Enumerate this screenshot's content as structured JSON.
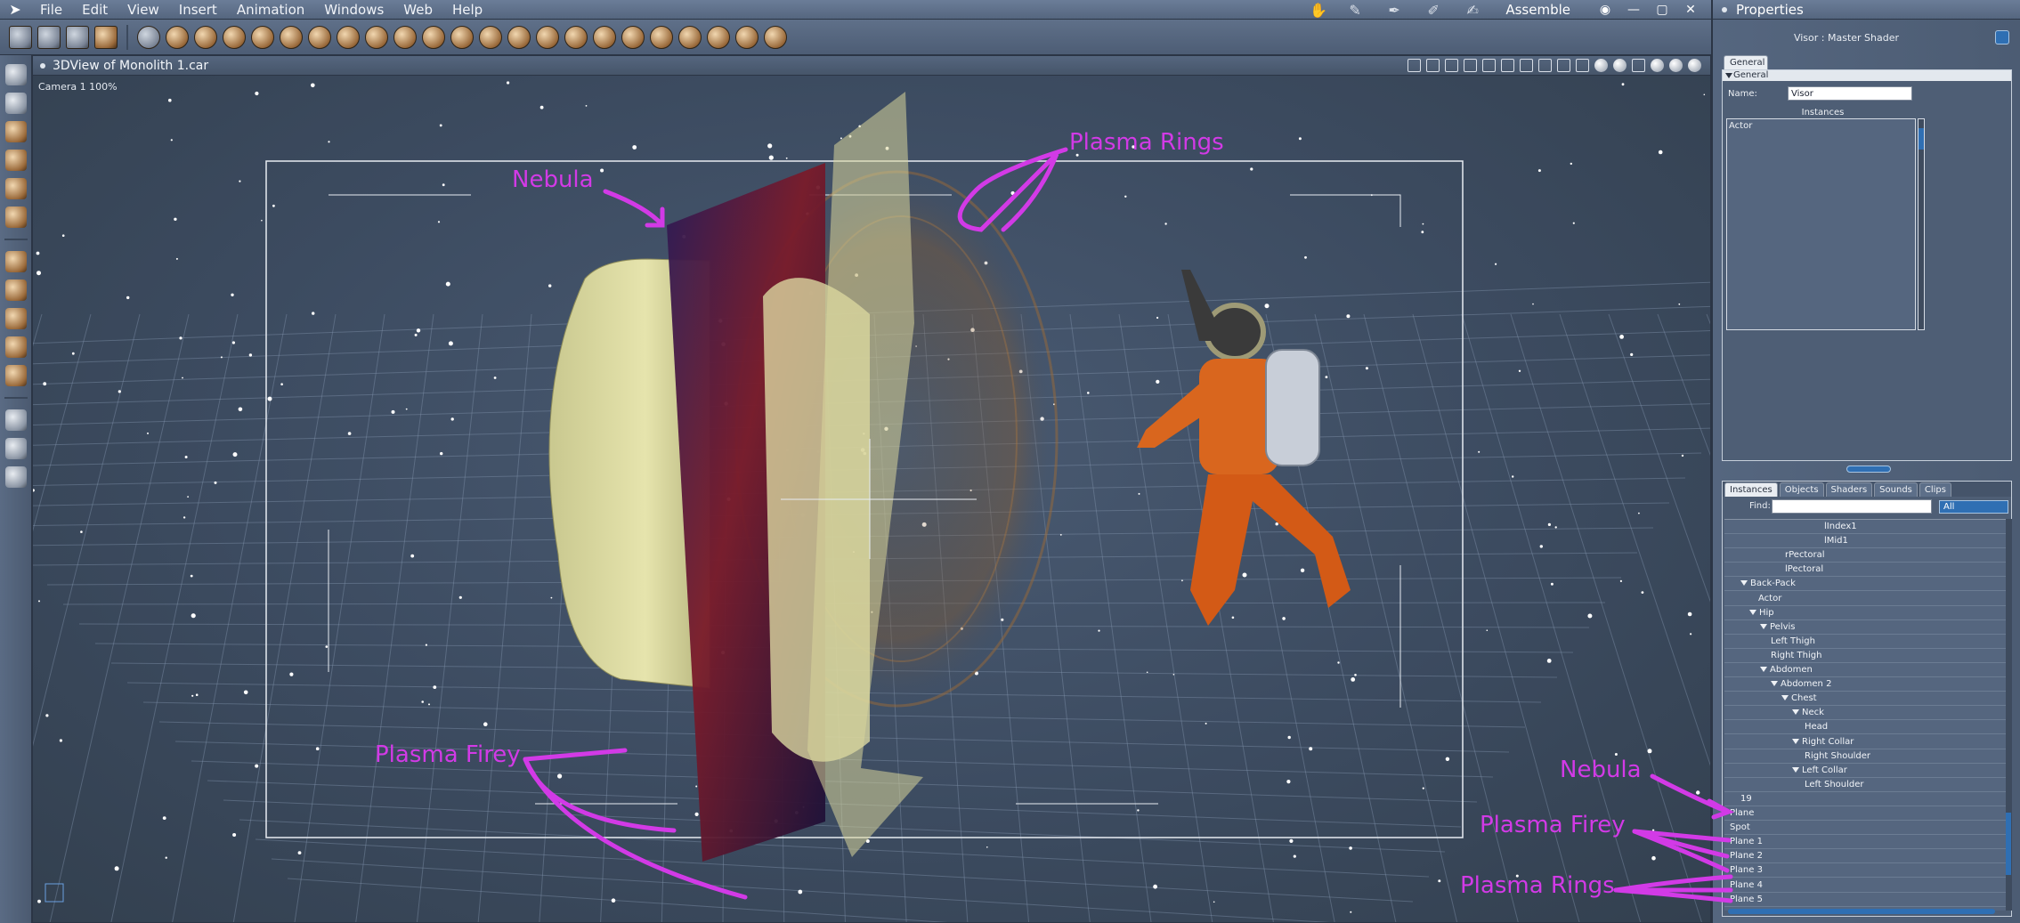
{
  "menubar": {
    "items": [
      "File",
      "Edit",
      "View",
      "Insert",
      "Animation",
      "Windows",
      "Web",
      "Help"
    ],
    "room": "Assemble",
    "window_controls": [
      "◉",
      "—",
      "▢",
      "✕"
    ]
  },
  "viewport": {
    "title": "3DView of Monolith 1.car",
    "camera_label": "Camera 1 100%"
  },
  "annotations": {
    "color": "#d23ae6",
    "nebula": "Nebula",
    "plasma_rings": "Plasma Rings",
    "plasma_firey": "Plasma Firey"
  },
  "properties": {
    "title": "Properties",
    "shader_label": "Visor : Master Shader",
    "tab": "General",
    "section": "General",
    "name_label": "Name:",
    "name_value": "Visor",
    "instances_label": "Instances",
    "instances": [
      "Actor"
    ]
  },
  "library": {
    "tabs": [
      "Instances",
      "Objects",
      "Shaders",
      "Sounds",
      "Clips"
    ],
    "find_label": "Find:",
    "find_value": "",
    "filter": "All",
    "tree": [
      {
        "label": "lIndex1",
        "indent": 112,
        "open": false
      },
      {
        "label": "lMid1",
        "indent": 112,
        "open": false
      },
      {
        "label": "rPectoral",
        "indent": 68,
        "open": false
      },
      {
        "label": "lPectoral",
        "indent": 68,
        "open": false
      },
      {
        "label": "Back-Pack",
        "indent": 18,
        "open": true
      },
      {
        "label": "Actor",
        "indent": 38,
        "open": false
      },
      {
        "label": "Hip",
        "indent": 28,
        "open": true
      },
      {
        "label": "Pelvis",
        "indent": 40,
        "open": true
      },
      {
        "label": "Left Thigh",
        "indent": 52,
        "open": false
      },
      {
        "label": "Right Thigh",
        "indent": 52,
        "open": false
      },
      {
        "label": "Abdomen",
        "indent": 40,
        "open": true
      },
      {
        "label": "Abdomen 2",
        "indent": 52,
        "open": true
      },
      {
        "label": "Chest",
        "indent": 64,
        "open": true
      },
      {
        "label": "Neck",
        "indent": 76,
        "open": true
      },
      {
        "label": "Head",
        "indent": 90,
        "open": false
      },
      {
        "label": "Right Collar",
        "indent": 76,
        "open": true
      },
      {
        "label": "Right Shoulder",
        "indent": 90,
        "open": false
      },
      {
        "label": "Left Collar",
        "indent": 76,
        "open": true
      },
      {
        "label": "Left Shoulder",
        "indent": 90,
        "open": false
      },
      {
        "label": "19",
        "indent": 18,
        "open": false
      },
      {
        "label": "Plane",
        "indent": 6,
        "open": false
      },
      {
        "label": "Spot",
        "indent": 6,
        "open": false
      },
      {
        "label": "Plane 1",
        "indent": 6,
        "open": false
      },
      {
        "label": "Plane 2",
        "indent": 6,
        "open": false
      },
      {
        "label": "Plane 3",
        "indent": 6,
        "open": false
      },
      {
        "label": "Plane 4",
        "indent": 6,
        "open": false
      },
      {
        "label": "Plane 5",
        "indent": 6,
        "open": false
      }
    ]
  }
}
